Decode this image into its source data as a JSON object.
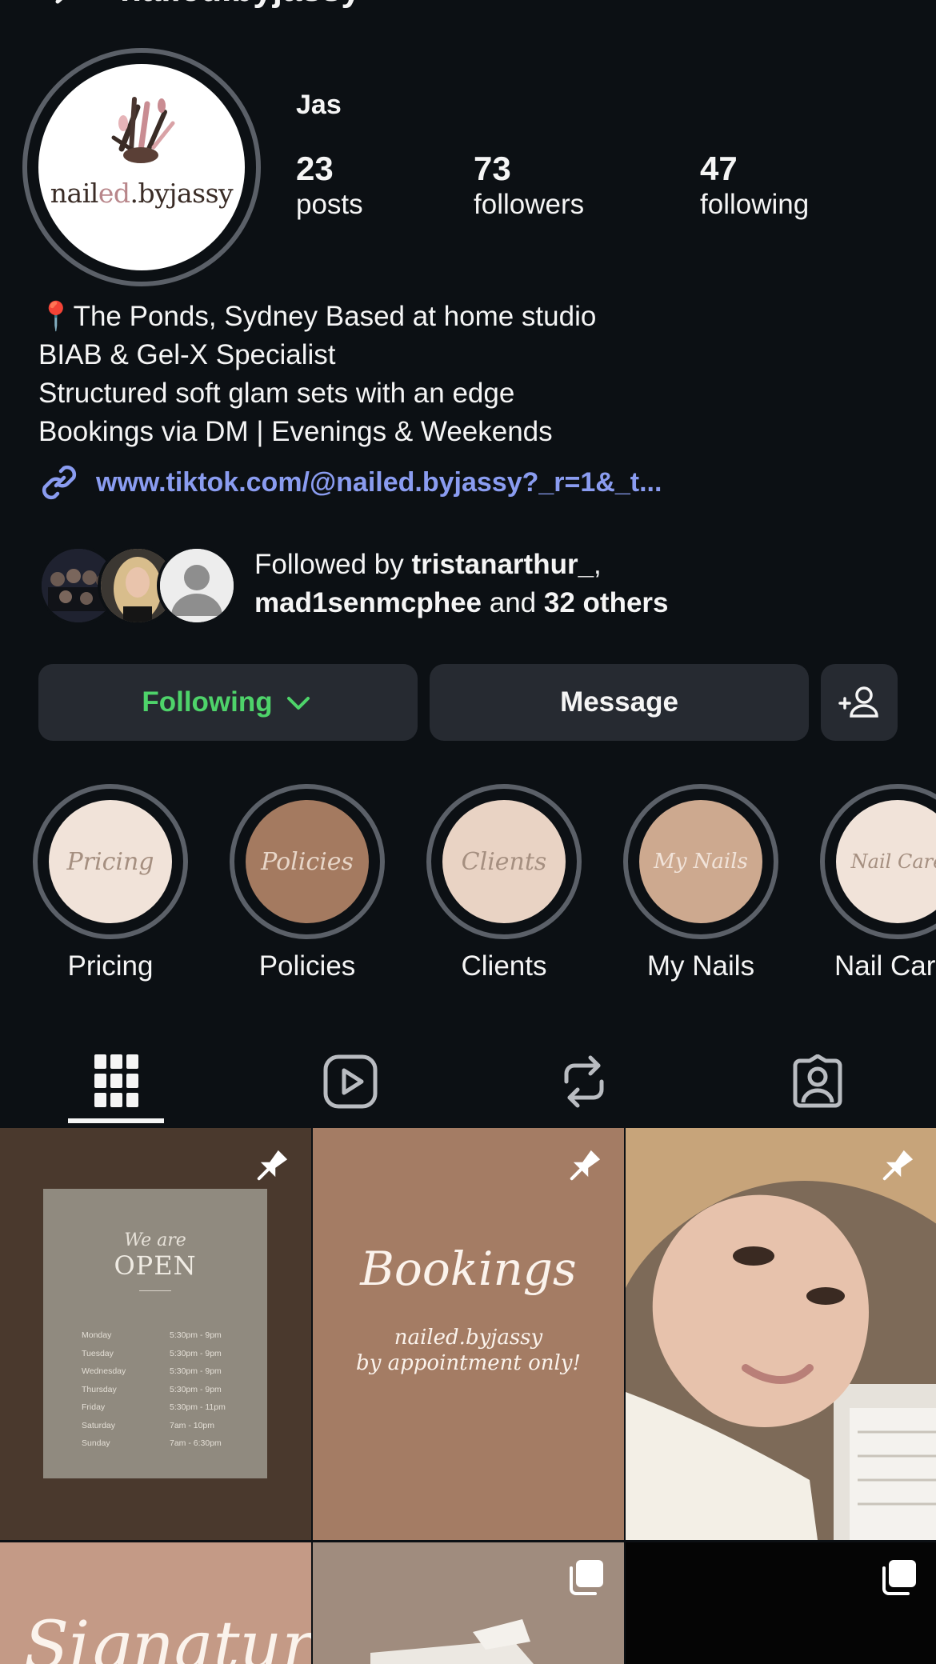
{
  "header": {
    "username": "nailed.byjassy"
  },
  "profile": {
    "logo_text_1": "nail",
    "logo_text_2": "ed",
    "logo_text_3": ".byjassy",
    "display_name": "Jas",
    "stats": [
      {
        "value": "23",
        "label": "posts"
      },
      {
        "value": "73",
        "label": "followers"
      },
      {
        "value": "47",
        "label": "following"
      }
    ],
    "bio": [
      "📍The Ponds, Sydney Based at home studio",
      "BIAB & Gel-X Specialist",
      "Structured soft glam sets with an edge",
      "Bookings via DM | Evenings & Weekends"
    ],
    "link": "www.tiktok.com/@nailed.byjassy?_r=1&_t..."
  },
  "followed_by": {
    "prefix": "Followed by ",
    "user1": "tristanarthur_",
    "sep": ",",
    "user2": "mad1senmcphee",
    "and": " and ",
    "others": "32 others"
  },
  "actions": {
    "following_label": "Following",
    "message_label": "Message"
  },
  "highlights": [
    {
      "label": "Pricing",
      "cover": "Pricing",
      "color": "#f1e3d9"
    },
    {
      "label": "Policies",
      "cover": "Policies",
      "color": "#a47a60"
    },
    {
      "label": "Clients",
      "cover": "Clients",
      "color": "#e9d3c4"
    },
    {
      "label": "My Nails",
      "cover": "My Nails",
      "color": "#cda98f"
    },
    {
      "label": "Nail Care",
      "cover": "Nail Care",
      "color": "#f1e3d9"
    }
  ],
  "tabs": [
    {
      "name": "posts-grid-icon"
    },
    {
      "name": "reels-icon"
    },
    {
      "name": "reposts-icon"
    },
    {
      "name": "tagged-icon"
    }
  ],
  "posts": {
    "open_card": {
      "we_are": "We are",
      "open": "OPEN",
      "hours": [
        {
          "day": "Monday",
          "time": "5:30pm - 9pm"
        },
        {
          "day": "Tuesday",
          "time": "5:30pm - 9pm"
        },
        {
          "day": "Wednesday",
          "time": "5:30pm - 9pm"
        },
        {
          "day": "Thursday",
          "time": "5:30pm - 9pm"
        },
        {
          "day": "Friday",
          "time": "5:30pm - 11pm"
        },
        {
          "day": "Saturday",
          "time": "7am - 10pm"
        },
        {
          "day": "Sunday",
          "time": "7am - 6:30pm"
        }
      ]
    },
    "bookings_card": {
      "title": "Bookings",
      "line1": "nailed.byjassy",
      "line2": "by appointment only!"
    },
    "signature_text": "Signature"
  },
  "colors": {
    "background": "#0c1014",
    "button_bg": "#262a31",
    "following_green": "#4ed36a",
    "link_blue": "#8a9cf0"
  }
}
